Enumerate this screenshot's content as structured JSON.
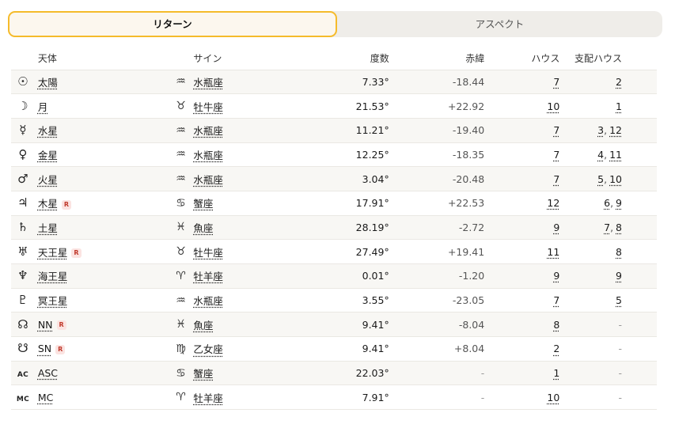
{
  "tabs": [
    {
      "label": "リターン",
      "active": true
    },
    {
      "label": "アスペクト",
      "active": false
    }
  ],
  "columns": {
    "body": "天体",
    "sign": "サイン",
    "degree": "度数",
    "declination": "赤緯",
    "house": "ハウス",
    "ruled": "支配ハウス"
  },
  "retro_label": "R",
  "rows": [
    {
      "key": "sun",
      "icon": "sun-icon",
      "glyph": "☉",
      "name": "太陽",
      "retro": false,
      "sign_icon": "aquarius-icon",
      "sign_glyph": "♒",
      "sign": "水瓶座",
      "degree": "7.33°",
      "declination": "-18.44",
      "house": "7",
      "ruled": [
        "2"
      ]
    },
    {
      "key": "moon",
      "icon": "moon-icon",
      "glyph": "☽",
      "name": "月",
      "retro": false,
      "sign_icon": "taurus-icon",
      "sign_glyph": "♉",
      "sign": "牡牛座",
      "degree": "21.53°",
      "declination": "+22.92",
      "house": "10",
      "ruled": [
        "1"
      ]
    },
    {
      "key": "mercury",
      "icon": "mercury-icon",
      "glyph": "☿",
      "name": "水星",
      "retro": false,
      "sign_icon": "aquarius-icon",
      "sign_glyph": "♒",
      "sign": "水瓶座",
      "degree": "11.21°",
      "declination": "-19.40",
      "house": "7",
      "ruled": [
        "3",
        "12"
      ]
    },
    {
      "key": "venus",
      "icon": "venus-icon",
      "glyph": "♀",
      "name": "金星",
      "retro": false,
      "sign_icon": "aquarius-icon",
      "sign_glyph": "♒",
      "sign": "水瓶座",
      "degree": "12.25°",
      "declination": "-18.35",
      "house": "7",
      "ruled": [
        "4",
        "11"
      ]
    },
    {
      "key": "mars",
      "icon": "mars-icon",
      "glyph": "♂",
      "name": "火星",
      "retro": false,
      "sign_icon": "aquarius-icon",
      "sign_glyph": "♒",
      "sign": "水瓶座",
      "degree": "3.04°",
      "declination": "-20.48",
      "house": "7",
      "ruled": [
        "5",
        "10"
      ]
    },
    {
      "key": "jupiter",
      "icon": "jupiter-icon",
      "glyph": "♃",
      "name": "木星",
      "retro": true,
      "sign_icon": "cancer-icon",
      "sign_glyph": "♋",
      "sign": "蟹座",
      "degree": "17.91°",
      "declination": "+22.53",
      "house": "12",
      "ruled": [
        "6",
        "9"
      ]
    },
    {
      "key": "saturn",
      "icon": "saturn-icon",
      "glyph": "♄",
      "name": "土星",
      "retro": false,
      "sign_icon": "pisces-icon",
      "sign_glyph": "♓",
      "sign": "魚座",
      "degree": "28.19°",
      "declination": "-2.72",
      "house": "9",
      "ruled": [
        "7",
        "8"
      ]
    },
    {
      "key": "uranus",
      "icon": "uranus-icon",
      "glyph": "♅",
      "name": "天王星",
      "retro": true,
      "sign_icon": "taurus-icon",
      "sign_glyph": "♉",
      "sign": "牡牛座",
      "degree": "27.49°",
      "declination": "+19.41",
      "house": "11",
      "ruled": [
        "8"
      ]
    },
    {
      "key": "neptune",
      "icon": "neptune-icon",
      "glyph": "♆",
      "name": "海王星",
      "retro": false,
      "sign_icon": "aries-icon",
      "sign_glyph": "♈",
      "sign": "牡羊座",
      "degree": "0.01°",
      "declination": "-1.20",
      "house": "9",
      "ruled": [
        "9"
      ]
    },
    {
      "key": "pluto",
      "icon": "pluto-icon",
      "glyph": "♇",
      "name": "冥王星",
      "retro": false,
      "sign_icon": "aquarius-icon",
      "sign_glyph": "♒",
      "sign": "水瓶座",
      "degree": "3.55°",
      "declination": "-23.05",
      "house": "7",
      "ruled": [
        "5"
      ]
    },
    {
      "key": "nn",
      "icon": "north-node-icon",
      "glyph": "☊",
      "name": "NN",
      "retro": true,
      "sign_icon": "pisces-icon",
      "sign_glyph": "♓",
      "sign": "魚座",
      "degree": "9.41°",
      "declination": "-8.04",
      "house": "8",
      "ruled": []
    },
    {
      "key": "sn",
      "icon": "south-node-icon",
      "glyph": "☋",
      "name": "SN",
      "retro": true,
      "sign_icon": "virgo-icon",
      "sign_glyph": "♍",
      "sign": "乙女座",
      "degree": "9.41°",
      "declination": "+8.04",
      "house": "2",
      "ruled": []
    },
    {
      "key": "asc",
      "icon": "asc-icon",
      "glyph": "AC",
      "glyph_text": true,
      "name": "ASC",
      "retro": false,
      "sign_icon": "cancer-icon",
      "sign_glyph": "♋",
      "sign": "蟹座",
      "degree": "22.03°",
      "declination": "-",
      "house": "1",
      "ruled": []
    },
    {
      "key": "mc",
      "icon": "mc-icon",
      "glyph": "MC",
      "glyph_text": true,
      "name": "MC",
      "retro": false,
      "sign_icon": "aries-icon",
      "sign_glyph": "♈",
      "sign": "牡羊座",
      "degree": "7.91°",
      "declination": "-",
      "house": "10",
      "ruled": []
    }
  ],
  "empty_value": "-",
  "colors": {
    "active_tab_border": "#f5bb2b",
    "retro_badge": "#c0392b"
  }
}
